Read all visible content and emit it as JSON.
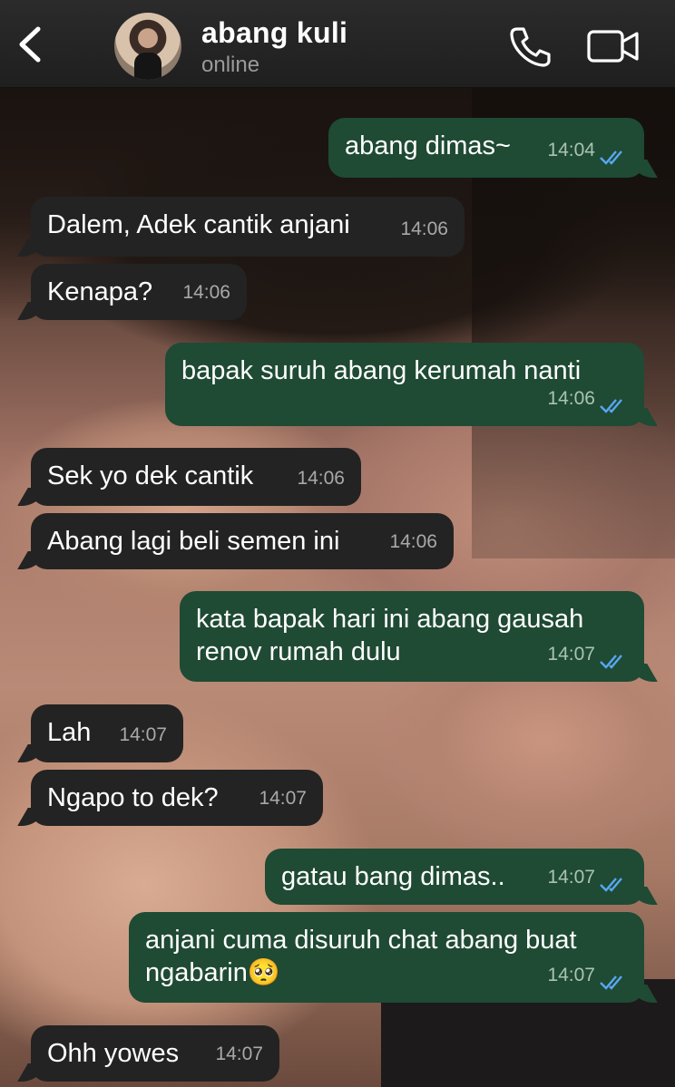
{
  "header": {
    "contact_name": "abang kuli",
    "status": "online"
  },
  "icons": {
    "back": "chevron-left-icon",
    "call": "phone-icon",
    "video": "video-camera-icon",
    "read": "double-check-icon"
  },
  "colors": {
    "incoming_bubble": "#232323",
    "outgoing_bubble": "#1f4a34",
    "read_check": "#58a7f1",
    "header_bg": "#262626"
  },
  "messages": [
    {
      "dir": "out",
      "text": "abang dimas~",
      "time": "14:04",
      "read": true
    },
    {
      "dir": "in",
      "text": "Dalem, Adek cantik anjani",
      "time": "14:06"
    },
    {
      "dir": "in",
      "text": "Kenapa?",
      "time": "14:06"
    },
    {
      "dir": "out",
      "text": "bapak suruh abang kerumah nanti",
      "time": "14:06",
      "read": true
    },
    {
      "dir": "in",
      "text": "Sek yo dek cantik",
      "time": "14:06"
    },
    {
      "dir": "in",
      "text": "Abang lagi beli semen ini",
      "time": "14:06"
    },
    {
      "dir": "out",
      "text": "kata bapak hari ini abang gausah renov rumah dulu",
      "time": "14:07",
      "read": true
    },
    {
      "dir": "in",
      "text": "Lah",
      "time": "14:07"
    },
    {
      "dir": "in",
      "text": "Ngapo to dek?",
      "time": "14:07"
    },
    {
      "dir": "out",
      "text": "gatau bang dimas..",
      "time": "14:07",
      "read": true
    },
    {
      "dir": "out",
      "text": "anjani cuma disuruh chat abang buat ngabarin🥺",
      "time": "14:07",
      "read": true
    },
    {
      "dir": "in",
      "text": "Ohh yowes",
      "time": "14:07"
    }
  ]
}
